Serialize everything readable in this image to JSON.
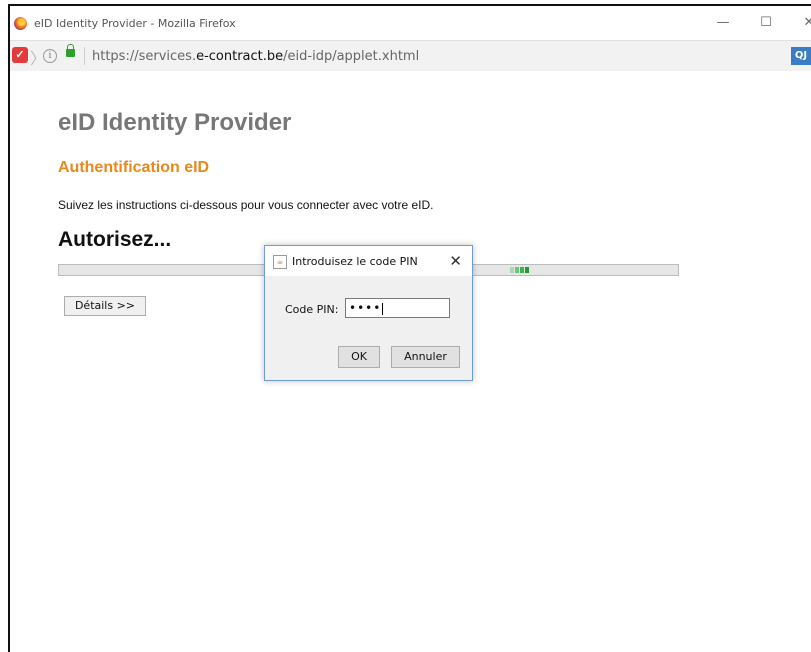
{
  "window": {
    "title": "eID Identity Provider - Mozilla Firefox",
    "controls": {
      "minimize": "—",
      "maximize": "☐",
      "close": "✕"
    }
  },
  "urlbar": {
    "url_prefix": "https://services.",
    "url_domain": "e-contract.be",
    "url_path": "/eid-idp/applet.xhtml",
    "extension_label": "QJ"
  },
  "page": {
    "title": "eID Identity Provider",
    "subtitle": "Authentification eID",
    "instructions": "Suivez les instructions ci-dessous pour vous connecter avec votre eID.",
    "status": "Autorisez...",
    "details_button": "Détails >>"
  },
  "colors": {
    "title_gray": "#777777",
    "subtitle_orange": "#e8891c",
    "progress_green": "#3cb34a"
  },
  "dialog": {
    "title": "Introduisez le code PIN",
    "pin_label": "Code PIN:",
    "pin_value": "••••",
    "ok_label": "OK",
    "cancel_label": "Annuler",
    "close_glyph": "✕"
  }
}
